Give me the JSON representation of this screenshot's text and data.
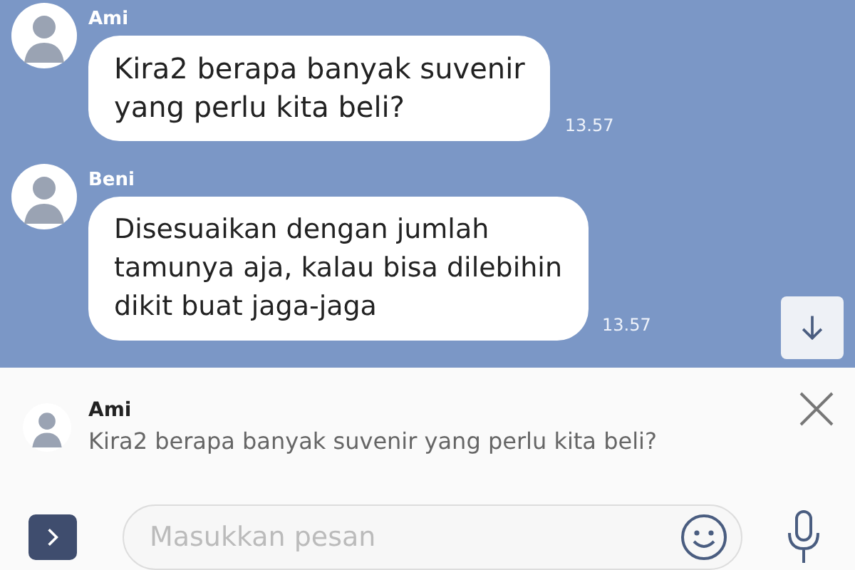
{
  "messages": [
    {
      "sender": "Ami",
      "text": "Kira2 berapa banyak suvenir\nyang perlu kita beli?",
      "time": "13.57"
    },
    {
      "sender": "Beni",
      "text": "Disesuaikan dengan jumlah\ntamunya aja, kalau bisa dilebihin\ndikit buat jaga-jaga",
      "time": "13.57"
    }
  ],
  "reply_preview": {
    "sender": "Ami",
    "text": "Kira2 berapa banyak suvenir yang perlu kita beli?"
  },
  "composer": {
    "placeholder": "Masukkan pesan"
  }
}
